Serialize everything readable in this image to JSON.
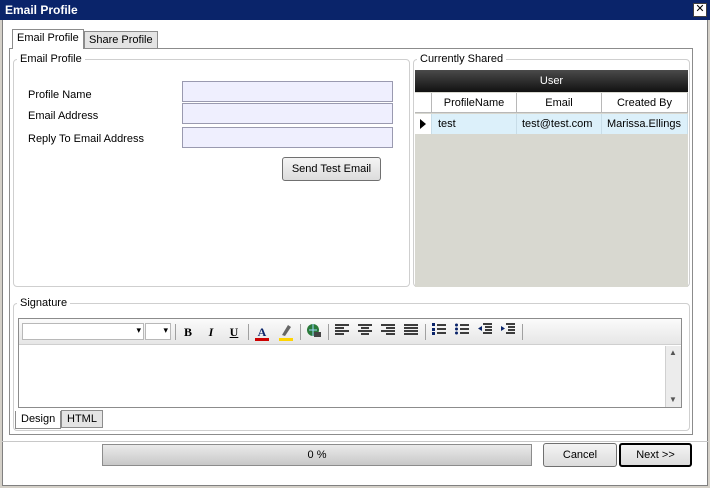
{
  "window": {
    "title": "Email Profile",
    "close_glyph": "✕"
  },
  "tabs": [
    {
      "label": "Email Profile",
      "active": true
    },
    {
      "label": "Share Profile",
      "active": false
    }
  ],
  "email_profile": {
    "group_title": "Email Profile",
    "fields": [
      {
        "label": "Profile Name",
        "value": ""
      },
      {
        "label": "Email Address",
        "value": ""
      },
      {
        "label": "Reply To Email Address",
        "value": ""
      }
    ],
    "send_test_button": "Send Test Email"
  },
  "currently_shared": {
    "group_title": "Currently Shared",
    "band_header": "User",
    "columns": [
      "ProfileName",
      "Email",
      "Created By"
    ],
    "rows": [
      {
        "profile_name": "test",
        "email": "test@test.com",
        "created_by": "Marissa.Ellings"
      }
    ],
    "row_indicator_icon": "row-pointer-icon"
  },
  "signature": {
    "group_title": "Signature",
    "font_name_value": "",
    "font_size_value": "",
    "toolbar_icons": [
      "bold-icon",
      "italic-icon",
      "underline-icon",
      "font-color-icon",
      "highlight-icon",
      "hyperlink-icon",
      "align-left-icon",
      "align-center-icon",
      "align-right-icon",
      "justify-icon",
      "numbered-list-icon",
      "bullet-list-icon",
      "outdent-icon",
      "indent-icon"
    ],
    "bold_glyph": "B",
    "italic_glyph": "I",
    "underline_glyph": "U",
    "font_color_glyph": "A",
    "font_color": "#cc0000",
    "highlight_color": "#ffd400",
    "editor_content": "",
    "view_tabs": [
      {
        "label": "Design",
        "active": true
      },
      {
        "label": "HTML",
        "active": false
      }
    ]
  },
  "footer": {
    "progress_text": "0 %",
    "progress_fraction": 0,
    "cancel_button": "Cancel",
    "next_button": "Next >>"
  },
  "colors": {
    "titlebar": "#0a246a",
    "field_bg": "#efeffe",
    "grid_row_bg": "#dcf0fa"
  }
}
